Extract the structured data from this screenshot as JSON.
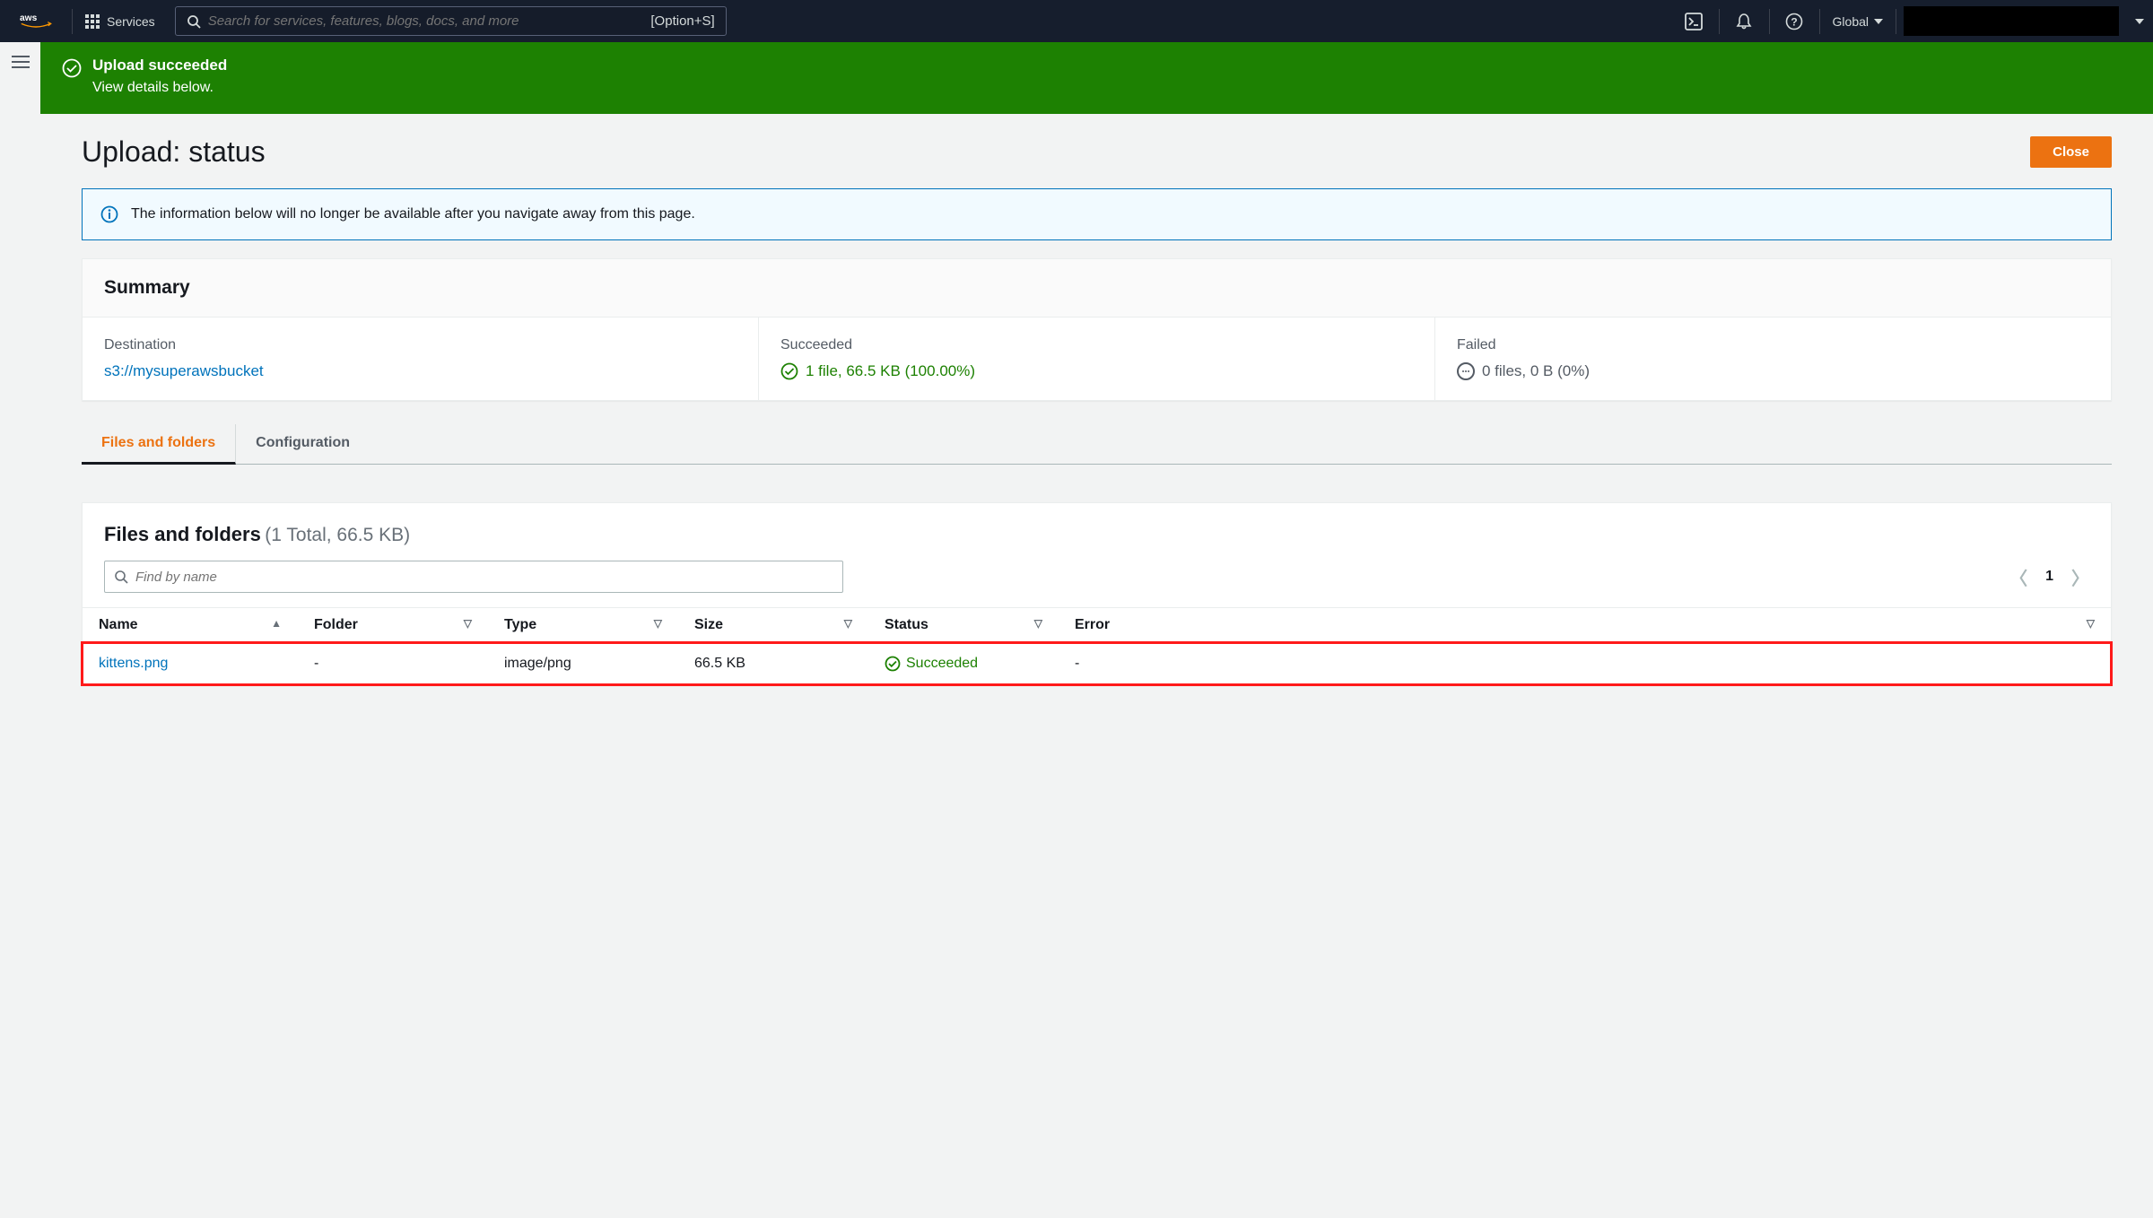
{
  "nav": {
    "services_label": "Services",
    "search_placeholder": "Search for services, features, blogs, docs, and more",
    "shortcut": "[Option+S]",
    "region": "Global"
  },
  "banner": {
    "title": "Upload succeeded",
    "sub": "View details below."
  },
  "page": {
    "title": "Upload: status",
    "close_label": "Close"
  },
  "info_alert": {
    "message": "The information below will no longer be available after you navigate away from this page."
  },
  "summary": {
    "heading": "Summary",
    "destination_label": "Destination",
    "destination_value": "s3://mysuperawsbucket",
    "succeeded_label": "Succeeded",
    "succeeded_value": "1 file, 66.5 KB (100.00%)",
    "failed_label": "Failed",
    "failed_value": "0 files, 0 B (0%)"
  },
  "tabs": {
    "files": "Files and folders",
    "config": "Configuration"
  },
  "files_section": {
    "title": "Files and folders",
    "subtitle": "(1 Total, 66.5 KB)",
    "filter_placeholder": "Find by name",
    "page_number": "1",
    "columns": {
      "name": "Name",
      "folder": "Folder",
      "type": "Type",
      "size": "Size",
      "status": "Status",
      "error": "Error"
    },
    "rows": [
      {
        "name": "kittens.png",
        "folder": "-",
        "type": "image/png",
        "size": "66.5 KB",
        "status": "Succeeded",
        "error": "-"
      }
    ]
  }
}
